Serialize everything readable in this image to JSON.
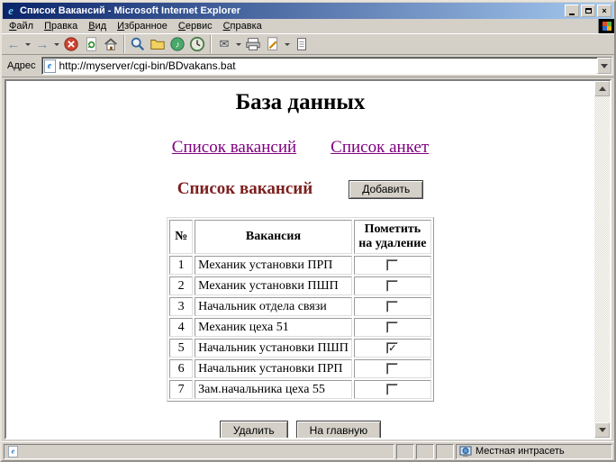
{
  "window": {
    "title": "Список Вакансий - Microsoft Internet Explorer",
    "controls": {
      "close": "×"
    }
  },
  "menu": {
    "items": [
      "Файл",
      "Правка",
      "Вид",
      "Избранное",
      "Сервис",
      "Справка"
    ]
  },
  "toolbar": {
    "icons": [
      "back",
      "forward",
      "stop",
      "refresh",
      "home",
      "search",
      "favorites",
      "media",
      "history",
      "mail",
      "print",
      "edit",
      "discuss"
    ]
  },
  "address": {
    "label": "Адрес",
    "url": "http://myserver/cgi-bin/BDvakans.bat"
  },
  "page": {
    "title": "База данных",
    "nav_links": [
      {
        "label": "Список вакансий"
      },
      {
        "label": "Список анкет"
      }
    ],
    "section_title": "Список вакансий",
    "add_button": "Добавить",
    "table": {
      "headers": [
        "№",
        "Вакансия",
        "Пометить на удаление"
      ],
      "rows": [
        {
          "num": "1",
          "vacancy": "Механик установки ПРП",
          "checked": false
        },
        {
          "num": "2",
          "vacancy": "Механик установки ПШП",
          "checked": false
        },
        {
          "num": "3",
          "vacancy": "Начальник отдела связи",
          "checked": false
        },
        {
          "num": "4",
          "vacancy": "Механик цеха 51",
          "checked": false
        },
        {
          "num": "5",
          "vacancy": "Начальник установки ПШП",
          "checked": true
        },
        {
          "num": "6",
          "vacancy": "Начальник установки ПРП",
          "checked": false
        },
        {
          "num": "7",
          "vacancy": "Зам.начальника цеха 55",
          "checked": false
        }
      ]
    },
    "delete_button": "Удалить",
    "home_button": "На главную"
  },
  "status": {
    "zone_label": "Местная интрасеть"
  },
  "colors": {
    "titlebar_start": "#0a246a",
    "titlebar_end": "#a6caf0",
    "chrome": "#d4d0c8",
    "link": "#800080",
    "section_heading": "#7d1f1f",
    "page_bg": "#ffffff"
  }
}
